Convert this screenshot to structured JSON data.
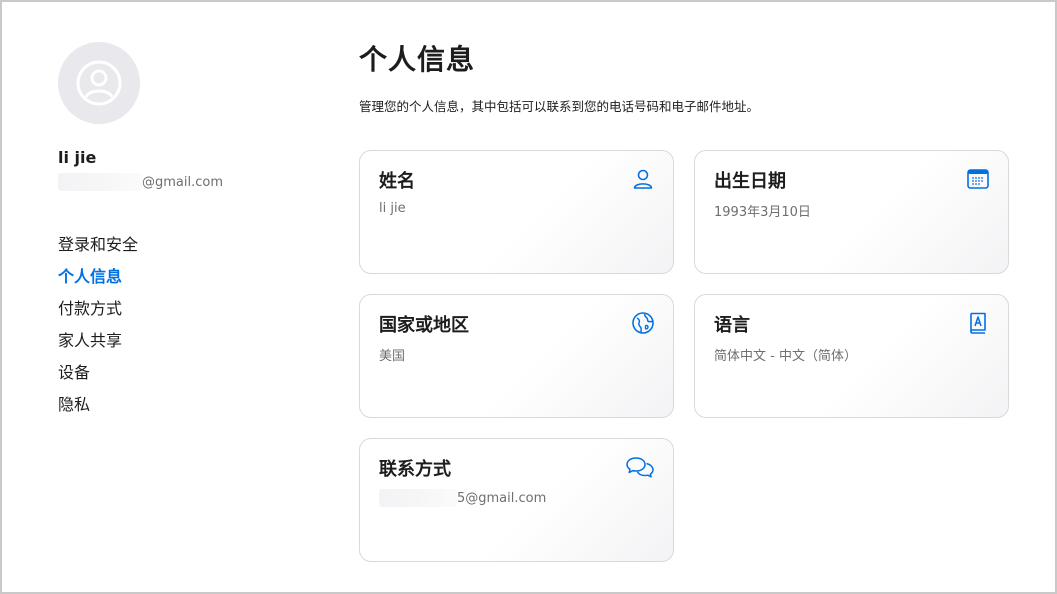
{
  "user": {
    "name": "li jie",
    "email_suffix": "@gmail.com"
  },
  "nav": {
    "items": [
      {
        "label": "登录和安全",
        "active": false
      },
      {
        "label": "个人信息",
        "active": true
      },
      {
        "label": "付款方式",
        "active": false
      },
      {
        "label": "家人共享",
        "active": false
      },
      {
        "label": "设备",
        "active": false
      },
      {
        "label": "隐私",
        "active": false
      }
    ]
  },
  "main": {
    "title": "个人信息",
    "subtitle": "管理您的个人信息，其中包括可以联系到您的电话号码和电子邮件地址。"
  },
  "cards": [
    {
      "title": "姓名",
      "value": "li jie",
      "icon": "person-icon"
    },
    {
      "title": "出生日期",
      "value": "1993年3月10日",
      "icon": "calendar-icon"
    },
    {
      "title": "国家或地区",
      "value": "美国",
      "icon": "globe-icon"
    },
    {
      "title": "语言",
      "value": "简体中文 - 中文（简体）",
      "icon": "language-book-icon"
    },
    {
      "title": "联系方式",
      "value": "5@gmail.com",
      "icon": "chat-bubbles-icon"
    }
  ],
  "colors": {
    "accent": "#0071e3",
    "text": "#1d1d1f",
    "secondary_text": "#6e6e73",
    "card_border": "#d9d9de",
    "avatar_bg": "#e8e8ed"
  }
}
